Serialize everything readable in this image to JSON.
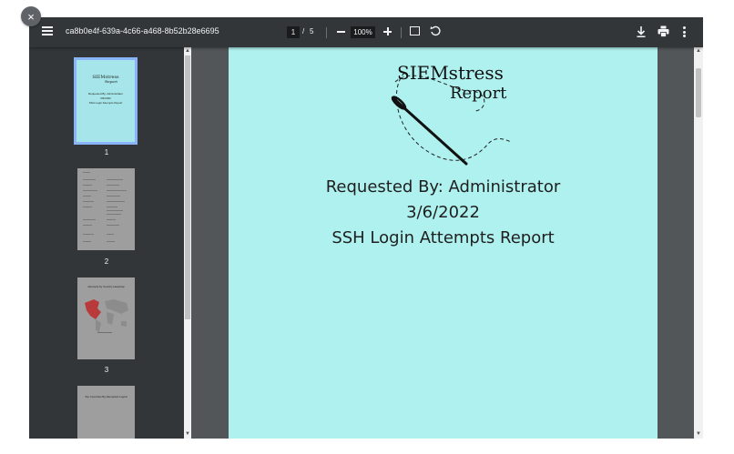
{
  "toolbar": {
    "title": "ca8b0e4f-639a-4c66-a468-8b52b28e6695",
    "page_current": "1",
    "page_sep": "/",
    "page_total": "5",
    "zoom": "100%"
  },
  "close_label": "×",
  "thumbnails": [
    {
      "number": "1"
    },
    {
      "number": "2"
    },
    {
      "number": "3"
    }
  ],
  "thumb1": {
    "logo_line1": "SIEMstress",
    "logo_line2": "Report",
    "line1": "Requested By: Administrator",
    "line2": "3/6/2022",
    "line3": "SSH Login Attempts Report"
  },
  "thumb3": {
    "title": "Attempts by Country Heatmap"
  },
  "thumb4": {
    "title": "Top Countries By Attempted Logins"
  },
  "page": {
    "logo_line1": "SIEMstress",
    "logo_line2": "Report",
    "requested_by": "Requested By: Administrator",
    "date": "3/6/2022",
    "report_title": "SSH Login Attempts Report"
  },
  "colors": {
    "toolbar_bg": "#323639",
    "viewer_bg": "#525659",
    "page_bg": "#aef1ee",
    "thumb_selected_border": "#8ab4f8"
  },
  "icons": [
    "close-icon",
    "menu-icon",
    "zoom-out-icon",
    "zoom-in-icon",
    "fit-page-icon",
    "rotate-icon",
    "download-icon",
    "print-icon",
    "more-options-icon",
    "needle-icon"
  ]
}
